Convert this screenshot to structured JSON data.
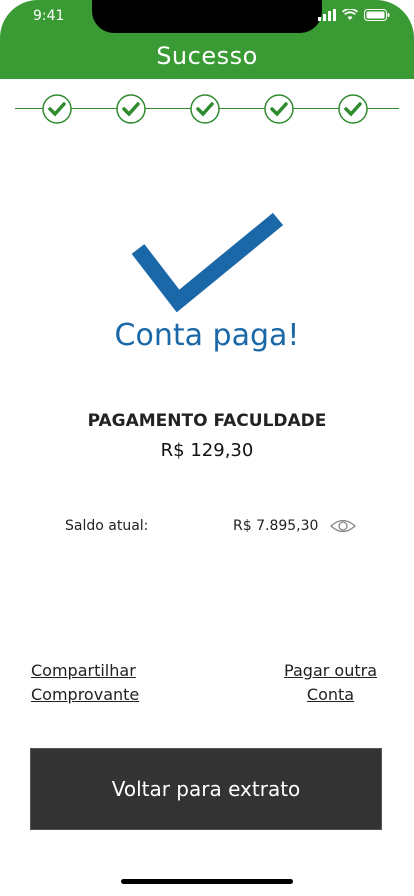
{
  "status_bar": {
    "time": "9:41"
  },
  "header": {
    "title": "Sucesso"
  },
  "stepper": {
    "steps": [
      {
        "label": "",
        "completed": true
      },
      {
        "label": "",
        "completed": true
      },
      {
        "label": "",
        "completed": true
      },
      {
        "label": "",
        "completed": true
      },
      {
        "label": "",
        "completed": true
      }
    ]
  },
  "result": {
    "title": "Conta paga!"
  },
  "payment": {
    "name": "PAGAMENTO FACULDADE",
    "amount": "R$ 129,30"
  },
  "balance": {
    "label": "Saldo atual:",
    "value": "R$ 7.895,30"
  },
  "links": {
    "share_line1": "Compartilhar",
    "share_line2": "Comprovante",
    "pay_line1": "Pagar outra",
    "pay_line2": "Conta"
  },
  "footer": {
    "back_button": "Voltar para extrato"
  },
  "colors": {
    "header": "#3a9b35",
    "check": "#1a68a8",
    "button": "#333333"
  },
  "icons": {
    "check": "check-icon",
    "eye": "eye-icon"
  }
}
